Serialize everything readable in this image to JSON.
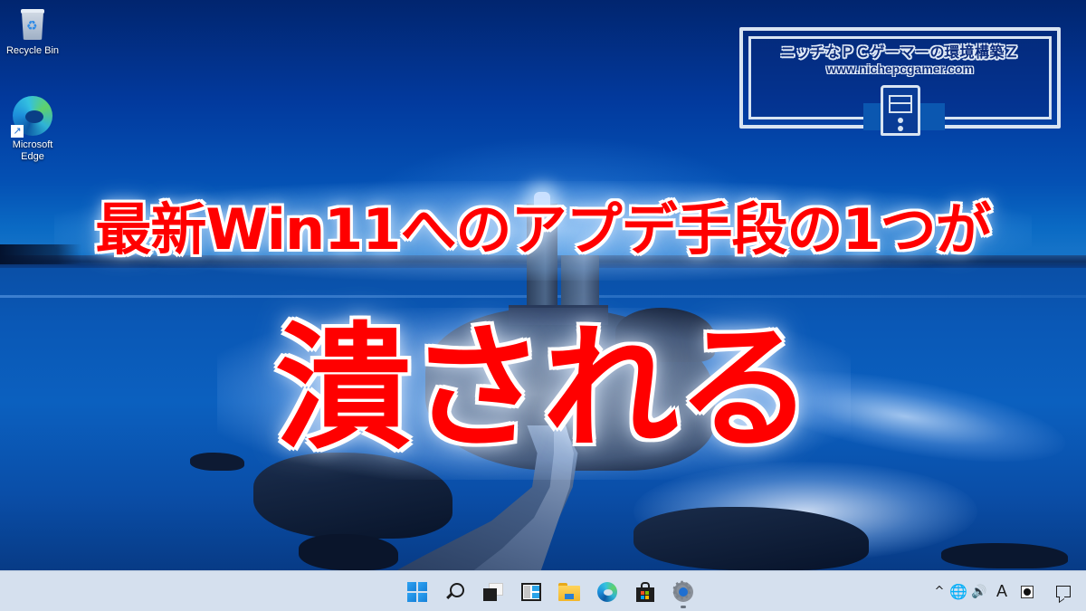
{
  "desktop": {
    "icons": [
      {
        "id": "recycle-bin",
        "label": "Recycle Bin",
        "icon": "recycle-bin-icon"
      },
      {
        "id": "microsoft-edge",
        "label": "Microsoft Edge",
        "label_lines": [
          "Microsoft",
          "Edge"
        ],
        "icon": "edge-icon",
        "shortcut": true
      }
    ]
  },
  "watermark": {
    "title": "ニッチなＰＣゲーマーの環境構築Ｚ",
    "url": "www.nichepcgamer.com",
    "icon": "pc-tower-icon"
  },
  "headline": {
    "line1": "最新Win11へのアプデ手段の1つが",
    "line2": "潰される",
    "text_color": "#ff0000",
    "outline_color": "#ffffff"
  },
  "taskbar": {
    "background": "#d5e0ee",
    "pinned": [
      {
        "id": "start",
        "icon": "windows-start-icon",
        "running": false
      },
      {
        "id": "search",
        "icon": "search-icon",
        "running": false
      },
      {
        "id": "task-view",
        "icon": "task-view-icon",
        "running": false
      },
      {
        "id": "widgets",
        "icon": "widgets-icon",
        "running": false
      },
      {
        "id": "file-explorer",
        "icon": "folder-icon",
        "running": false
      },
      {
        "id": "edge",
        "icon": "edge-icon",
        "running": false
      },
      {
        "id": "store",
        "icon": "microsoft-store-icon",
        "running": false
      },
      {
        "id": "settings",
        "icon": "gear-icon",
        "running": true
      }
    ],
    "tray": {
      "overflow_glyph": "^",
      "network_glyph": "🌐",
      "volume_glyph": "🔊",
      "ime_label": "A",
      "notification_icon": "notification-icon"
    }
  }
}
